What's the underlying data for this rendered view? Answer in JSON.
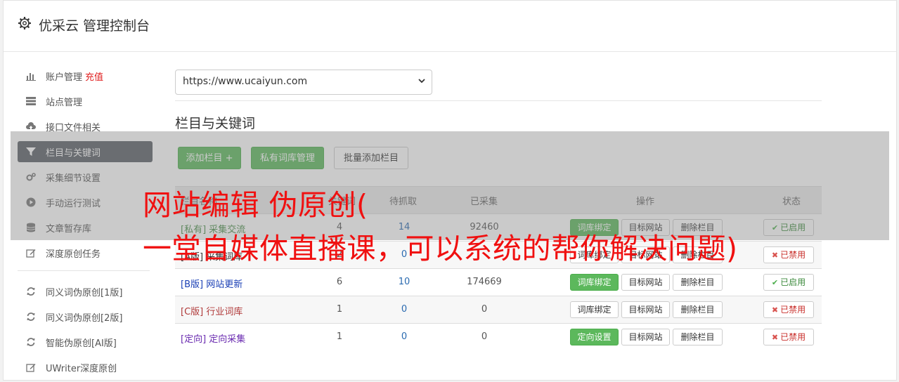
{
  "header": {
    "title": "优采云 管理控制台"
  },
  "sidebar": {
    "items": [
      {
        "label": "账户管理",
        "extra": "充值",
        "icon": "bar-chart-icon",
        "active": false
      },
      {
        "label": "站点管理",
        "icon": "server-icon",
        "active": false
      },
      {
        "label": "接口文件相关",
        "icon": "cloud-upload-icon",
        "active": false
      },
      {
        "label": "栏目与关键词",
        "icon": "filter-icon",
        "active": true
      },
      {
        "label": "采集细节设置",
        "icon": "gears-icon",
        "active": false
      },
      {
        "label": "手动运行测试",
        "icon": "play-circle-icon",
        "active": false
      },
      {
        "label": "文章暂存库",
        "icon": "database-icon",
        "active": false
      },
      {
        "label": "深度原创任务",
        "icon": "edit-icon",
        "active": false
      }
    ],
    "items2": [
      {
        "label": "同义词伪原创[1版]",
        "icon": "refresh-icon"
      },
      {
        "label": "同义词伪原创[2版]",
        "icon": "refresh-icon"
      },
      {
        "label": "智能伪原创[AI版]",
        "icon": "refresh-icon"
      },
      {
        "label": "UWriter深度原创",
        "icon": "edit-icon"
      }
    ]
  },
  "main": {
    "site_select": {
      "value": "https://www.ucaiyun.com"
    },
    "section_title": "栏目与关键词",
    "buttons": {
      "add_column": "添加栏目 +",
      "private_lib": "私有词库管理",
      "batch_add": "批量添加栏目"
    },
    "table": {
      "headers": {
        "name": "栏目名称",
        "keywords": "关键词",
        "pending": "待抓取",
        "collected": "已采集",
        "ops": "操作",
        "status": "状态"
      },
      "rows": [
        {
          "name": "[私有] 采集交流",
          "name_color": "#4a8f4a",
          "keywords": "4",
          "pending": "14",
          "collected": "92460",
          "op1": "词库绑定",
          "op1_green": true,
          "op2": "目标网站",
          "op3": "删除栏目",
          "status": "已启用",
          "enabled": true
        },
        {
          "name": "[A版] 采集词库",
          "name_color": "#333333",
          "keywords": "2",
          "pending": "0",
          "collected": "",
          "op1": "词库绑定",
          "op1_green": false,
          "op2": "目标网站",
          "op3": "删除栏目",
          "status": "已禁用",
          "enabled": false
        },
        {
          "name": "[B版] 网站更新",
          "name_color": "#1a3fb5",
          "keywords": "6",
          "pending": "10",
          "collected": "174669",
          "op1": "词库绑定",
          "op1_green": true,
          "op2": "目标网站",
          "op3": "删除栏目",
          "status": "已启用",
          "enabled": true
        },
        {
          "name": "[C版] 行业词库",
          "name_color": "#b03a3a",
          "keywords": "1",
          "pending": "0",
          "collected": "0",
          "op1": "词库绑定",
          "op1_green": false,
          "op2": "目标网站",
          "op3": "删除栏目",
          "status": "已禁用",
          "enabled": false
        },
        {
          "name": "[定向] 定向采集",
          "name_color": "#6a2bb0",
          "keywords": "1",
          "pending": "0",
          "collected": "0",
          "op1": "定向设置",
          "op1_green": true,
          "op2": "目标网站",
          "op3": "删除栏目",
          "status": "已禁用",
          "enabled": false
        }
      ]
    }
  },
  "overlay": {
    "line1": "网站编辑 伪原创(",
    "line2": "一堂自媒体直播课，可以系统的帮你解决问题)"
  }
}
